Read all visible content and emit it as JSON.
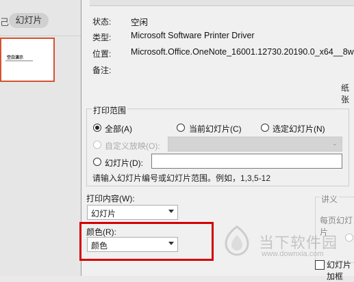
{
  "left_panel": {
    "tab_left_fragment": "己",
    "tab_slides": "幻灯片",
    "thumbnail_title": "空白演示"
  },
  "printer_info": {
    "rows": [
      {
        "label": "状态:",
        "value": "空闲"
      },
      {
        "label": "类型:",
        "value": "Microsoft Software Printer Driver"
      },
      {
        "label": "位置:",
        "value": "Microsoft.Office.OneNote_16001.12730.20190.0_x64__8w"
      },
      {
        "label": "备注:",
        "value": ""
      }
    ],
    "paper_hint": "纸张"
  },
  "print_range": {
    "title": "打印范围",
    "all": "全部(A)",
    "current": "当前幻灯片(C)",
    "selected": "选定幻灯片(N)",
    "custom_show": "自定义放映(O):",
    "slides": "幻灯片(D):",
    "slides_value": "",
    "hint": "请输入幻灯片编号或幻灯片范围。例如，1,3,5-12",
    "selected_option": "all"
  },
  "print_content": {
    "label": "打印内容(W):",
    "value": "幻灯片"
  },
  "color": {
    "label": "颜色(R):",
    "value": "颜色"
  },
  "handouts": {
    "title": "讲义",
    "per_page": "每页幻灯片",
    "frame_label": "幻灯片加框"
  },
  "watermark": {
    "text": "当下软件园",
    "url": "www.downxia.com"
  },
  "colors": {
    "accent_orange": "#d35230",
    "highlight_red": "#d40000"
  }
}
